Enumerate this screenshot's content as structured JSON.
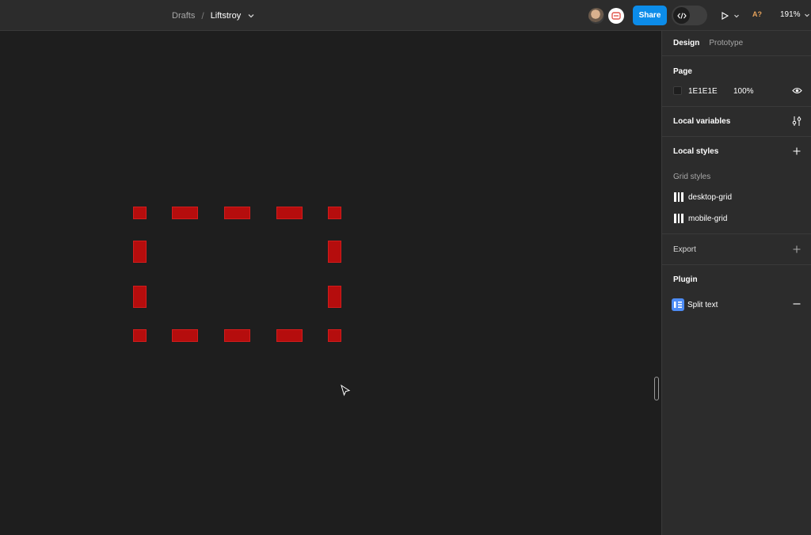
{
  "header": {
    "breadcrumb_root": "Drafts",
    "breadcrumb_sep": "/",
    "file_name": "Liftstroy",
    "share_label": "Share",
    "assist_badge": "A?",
    "zoom_level": "191%"
  },
  "panel": {
    "tabs": [
      {
        "label": "Design"
      },
      {
        "label": "Prototype"
      }
    ],
    "page": {
      "title": "Page",
      "color_hex": "1E1E1E",
      "opacity": "100%"
    },
    "local_variables": {
      "title": "Local variables"
    },
    "local_styles": {
      "title": "Local styles",
      "group_label": "Grid styles",
      "items": [
        {
          "label": "desktop-grid"
        },
        {
          "label": "mobile-grid"
        }
      ]
    },
    "export": {
      "title": "Export"
    },
    "plugin": {
      "title": "Plugin",
      "items": [
        {
          "label": "Split text"
        }
      ]
    }
  },
  "colors": {
    "accent": "#0c8ce9",
    "canvas_bg": "#1e1e1e",
    "panel_bg": "#2c2c2c",
    "shape_fill": "#b50d0d"
  },
  "icons": [
    "chevron-down-icon",
    "code-icon",
    "play-icon",
    "eye-icon",
    "variables-adjust-icon",
    "plus-icon",
    "grid-style-icon",
    "plugin-icon",
    "minus-icon",
    "pointer-cursor-icon"
  ]
}
